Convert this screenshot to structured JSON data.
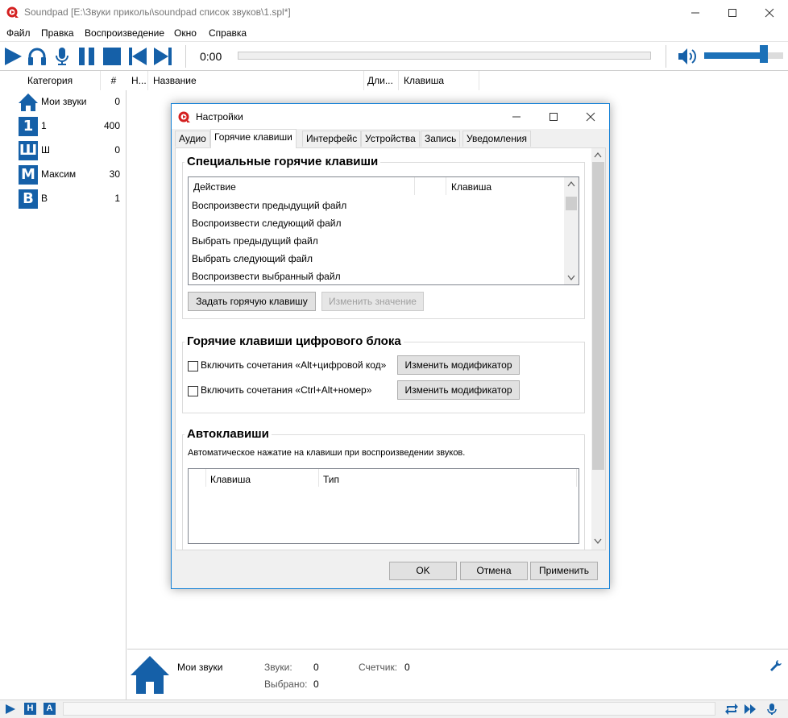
{
  "window": {
    "title": "Soundpad [E:\\Звуки приколы\\soundpad список звуков\\1.spl*]"
  },
  "menu": [
    "Файл",
    "Правка",
    "Воспроизведение",
    "Окно",
    "Справка"
  ],
  "player": {
    "time": "0:00",
    "volume_fraction": 0.75
  },
  "categories": {
    "col_name": "Категория",
    "col_count": "#",
    "items": [
      {
        "badge": "",
        "label": "Мои звуки",
        "count": "0",
        "icon": "home-icon"
      },
      {
        "badge": "1",
        "label": "1",
        "count": "400"
      },
      {
        "badge": "Ш",
        "label": "Ш",
        "count": "0"
      },
      {
        "badge": "М",
        "label": "Максим",
        "count": "30"
      },
      {
        "badge": "В",
        "label": "В",
        "count": "1"
      }
    ]
  },
  "sound_list": {
    "col_num": "Н...",
    "col_name": "Название",
    "col_duration": "Дли...",
    "col_hotkey": "Клавиша"
  },
  "info": {
    "category_name": "Мои звуки",
    "sounds_label": "Звуки:",
    "sounds_value": "0",
    "selected_label": "Выбрано:",
    "selected_value": "0",
    "counter_label": "Счетчик:",
    "counter_value": "0"
  },
  "statusbar": {
    "badge_n": "Н",
    "badge_a": "А"
  },
  "dialog": {
    "title": "Настройки",
    "tabs": [
      "Аудио",
      "Горячие клавиши",
      "Интерфейс",
      "Устройства",
      "Запись",
      "Уведомления"
    ],
    "active_tab": 1,
    "special": {
      "title": "Специальные горячие клавиши",
      "col_action": "Действие",
      "col_key": "Клавиша",
      "rows": [
        "Воспроизвести предыдущий файл",
        "Воспроизвести следующий файл",
        "Выбрать предыдущий файл",
        "Выбрать следующий файл",
        "Воспроизвести выбранный файл"
      ],
      "set_button": "Задать горячую клавишу",
      "change_button": "Изменить значение"
    },
    "numpad": {
      "title": "Горячие клавиши цифрового блока",
      "option1": "Включить сочетания «Alt+цифровой код»",
      "option2": "Включить сочетания «Ctrl+Alt+номер»",
      "modifier_button": "Изменить модификатор"
    },
    "autokeys": {
      "title": "Автоклавиши",
      "description": "Автоматическое нажатие на клавиши при воспроизведении звуков.",
      "col_key": "Клавиша",
      "col_type": "Тип"
    },
    "ok": "OK",
    "cancel": "Отмена",
    "apply": "Применить"
  },
  "colors": {
    "accent": "#1560a8",
    "dialog_border": "#1883d7"
  }
}
